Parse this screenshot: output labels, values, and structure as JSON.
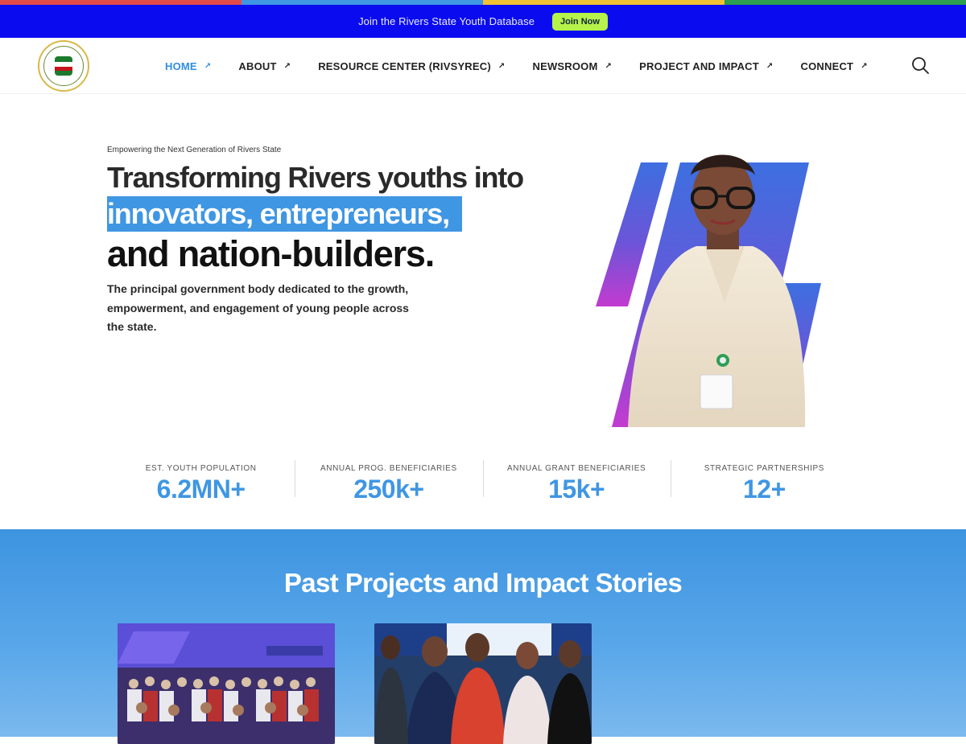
{
  "top_stripe_colors": [
    "#e34a4a",
    "#3f96e3",
    "#f1c232",
    "#2e9e4f"
  ],
  "announcement": {
    "text": "Join the Rivers State Youth Database",
    "button": "Join Now"
  },
  "nav": {
    "logo": "ministry-seal-logo",
    "items": [
      {
        "label": "HOME",
        "active": true
      },
      {
        "label": "ABOUT",
        "active": false
      },
      {
        "label": "RESOURCE CENTER (RIVSYREC)",
        "active": false
      },
      {
        "label": "NEWSROOM",
        "active": false
      },
      {
        "label": "PROJECT AND IMPACT",
        "active": false
      },
      {
        "label": "CONNECT",
        "active": false
      }
    ],
    "search_icon": "search-icon"
  },
  "hero": {
    "eyebrow": "Empowering the Next Generation of Rivers State",
    "title_line1": "Transforming Rivers youths into",
    "title_line2": "innovators, entrepreneurs,",
    "title_line3": "and nation-builders.",
    "description": "The principal government body dedicated to the growth, empowerment, and engagement of young people across the state."
  },
  "stats": [
    {
      "label": "EST. YOUTH POPULATION",
      "value": "6.2MN+"
    },
    {
      "label": "ANNUAL PROG. BENEFICIARIES",
      "value": "250k+"
    },
    {
      "label": "ANNUAL GRANT BENEFICIARIES",
      "value": "15k+"
    },
    {
      "label": "STRATEGIC PARTNERSHIPS",
      "value": "12+"
    }
  ],
  "projects": {
    "heading": "Past Projects and Impact Stories"
  },
  "colors": {
    "accent": "#3f96e3",
    "topbar": "#0b0bf0",
    "join_button": "#b5f24a"
  }
}
